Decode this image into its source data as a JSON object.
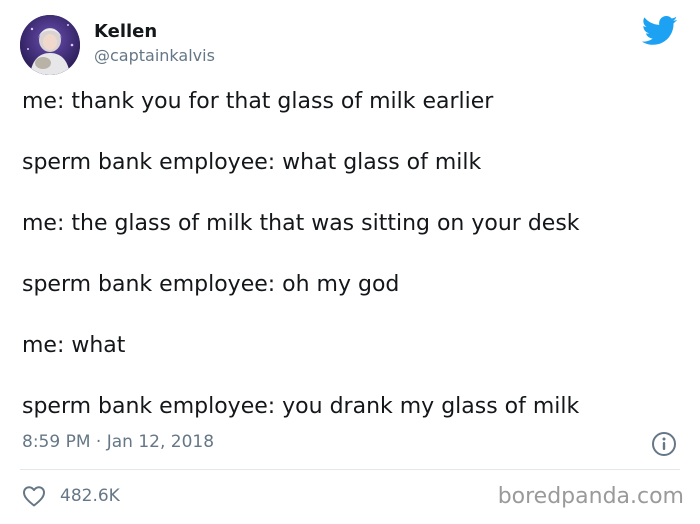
{
  "author": {
    "display_name": "Kellen",
    "handle": "@captainkalvis"
  },
  "tweet": {
    "lines": [
      "me: thank you for that glass of milk earlier",
      "sperm bank employee: what glass of milk",
      "me: the glass of milk that was sitting on your desk",
      "sperm bank employee: oh my god",
      "me: what",
      "sperm bank employee: you drank my glass of milk"
    ],
    "timestamp": "8:59 PM · Jan 12, 2018"
  },
  "engagement": {
    "likes": "482.6K"
  },
  "watermark": "boredpanda.com",
  "icons": {
    "brand": "twitter-bird-icon",
    "info": "info-icon",
    "like": "heart-icon"
  },
  "colors": {
    "twitter_blue": "#1da1f2",
    "text_primary": "#14171a",
    "text_secondary": "#657786",
    "divider": "#e1e8ed",
    "watermark": "#9a9a9a"
  }
}
